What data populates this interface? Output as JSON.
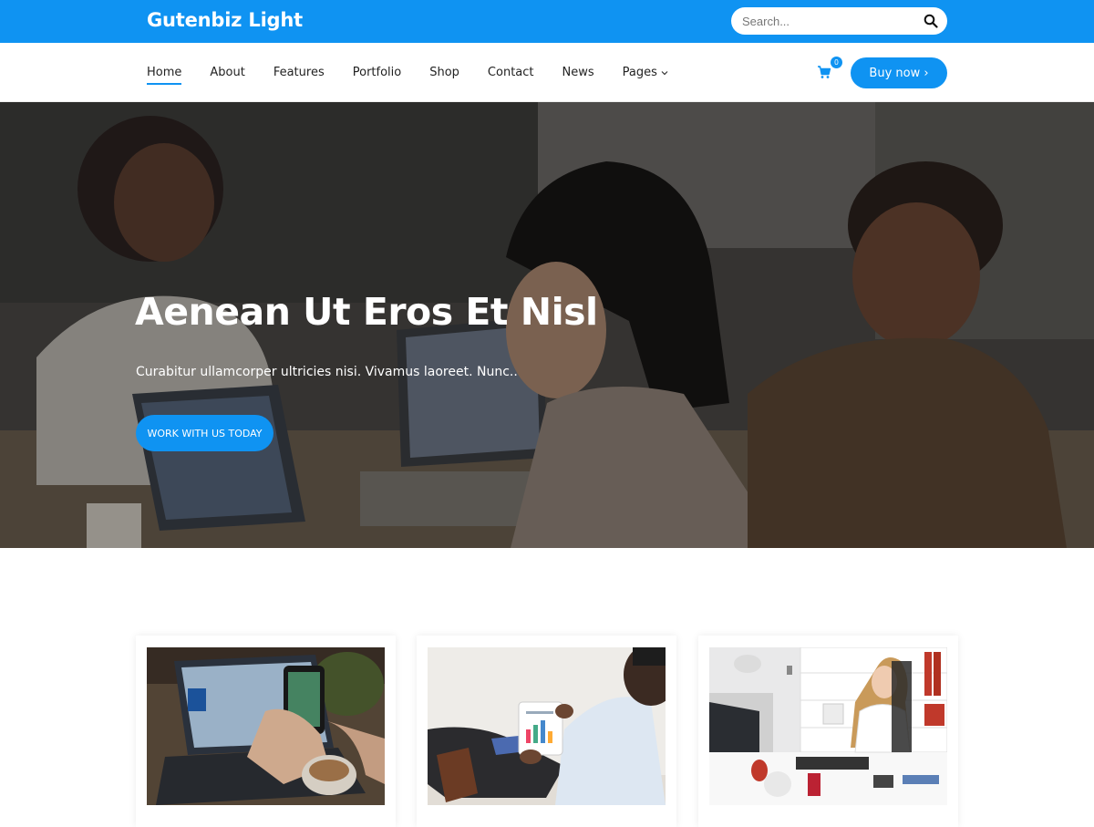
{
  "header": {
    "site_title": "Gutenbiz Light",
    "search_placeholder": "Search...",
    "search_icon": "search-icon",
    "brand_color": "#0f93f2"
  },
  "nav": {
    "items": [
      {
        "label": "Home",
        "active": true
      },
      {
        "label": "About"
      },
      {
        "label": "Features"
      },
      {
        "label": "Portfolio"
      },
      {
        "label": "Shop"
      },
      {
        "label": "Contact"
      },
      {
        "label": "News"
      },
      {
        "label": "Pages",
        "has_dropdown": true
      }
    ],
    "cart_icon": "cart-icon",
    "cart_count": "0",
    "buy_label": "Buy now ›"
  },
  "hero": {
    "title": "Aenean Ut Eros Et Nisl",
    "subtitle": "Curabitur ullamcorper ultricies nisi. Vivamus laoreet. Nunc..",
    "cta_label": "WORK WITH US TODAY"
  },
  "cards": [
    {
      "image": "laptop-phone-photo"
    },
    {
      "image": "tablet-chart-photo"
    },
    {
      "image": "office-woman-phone-photo"
    }
  ]
}
